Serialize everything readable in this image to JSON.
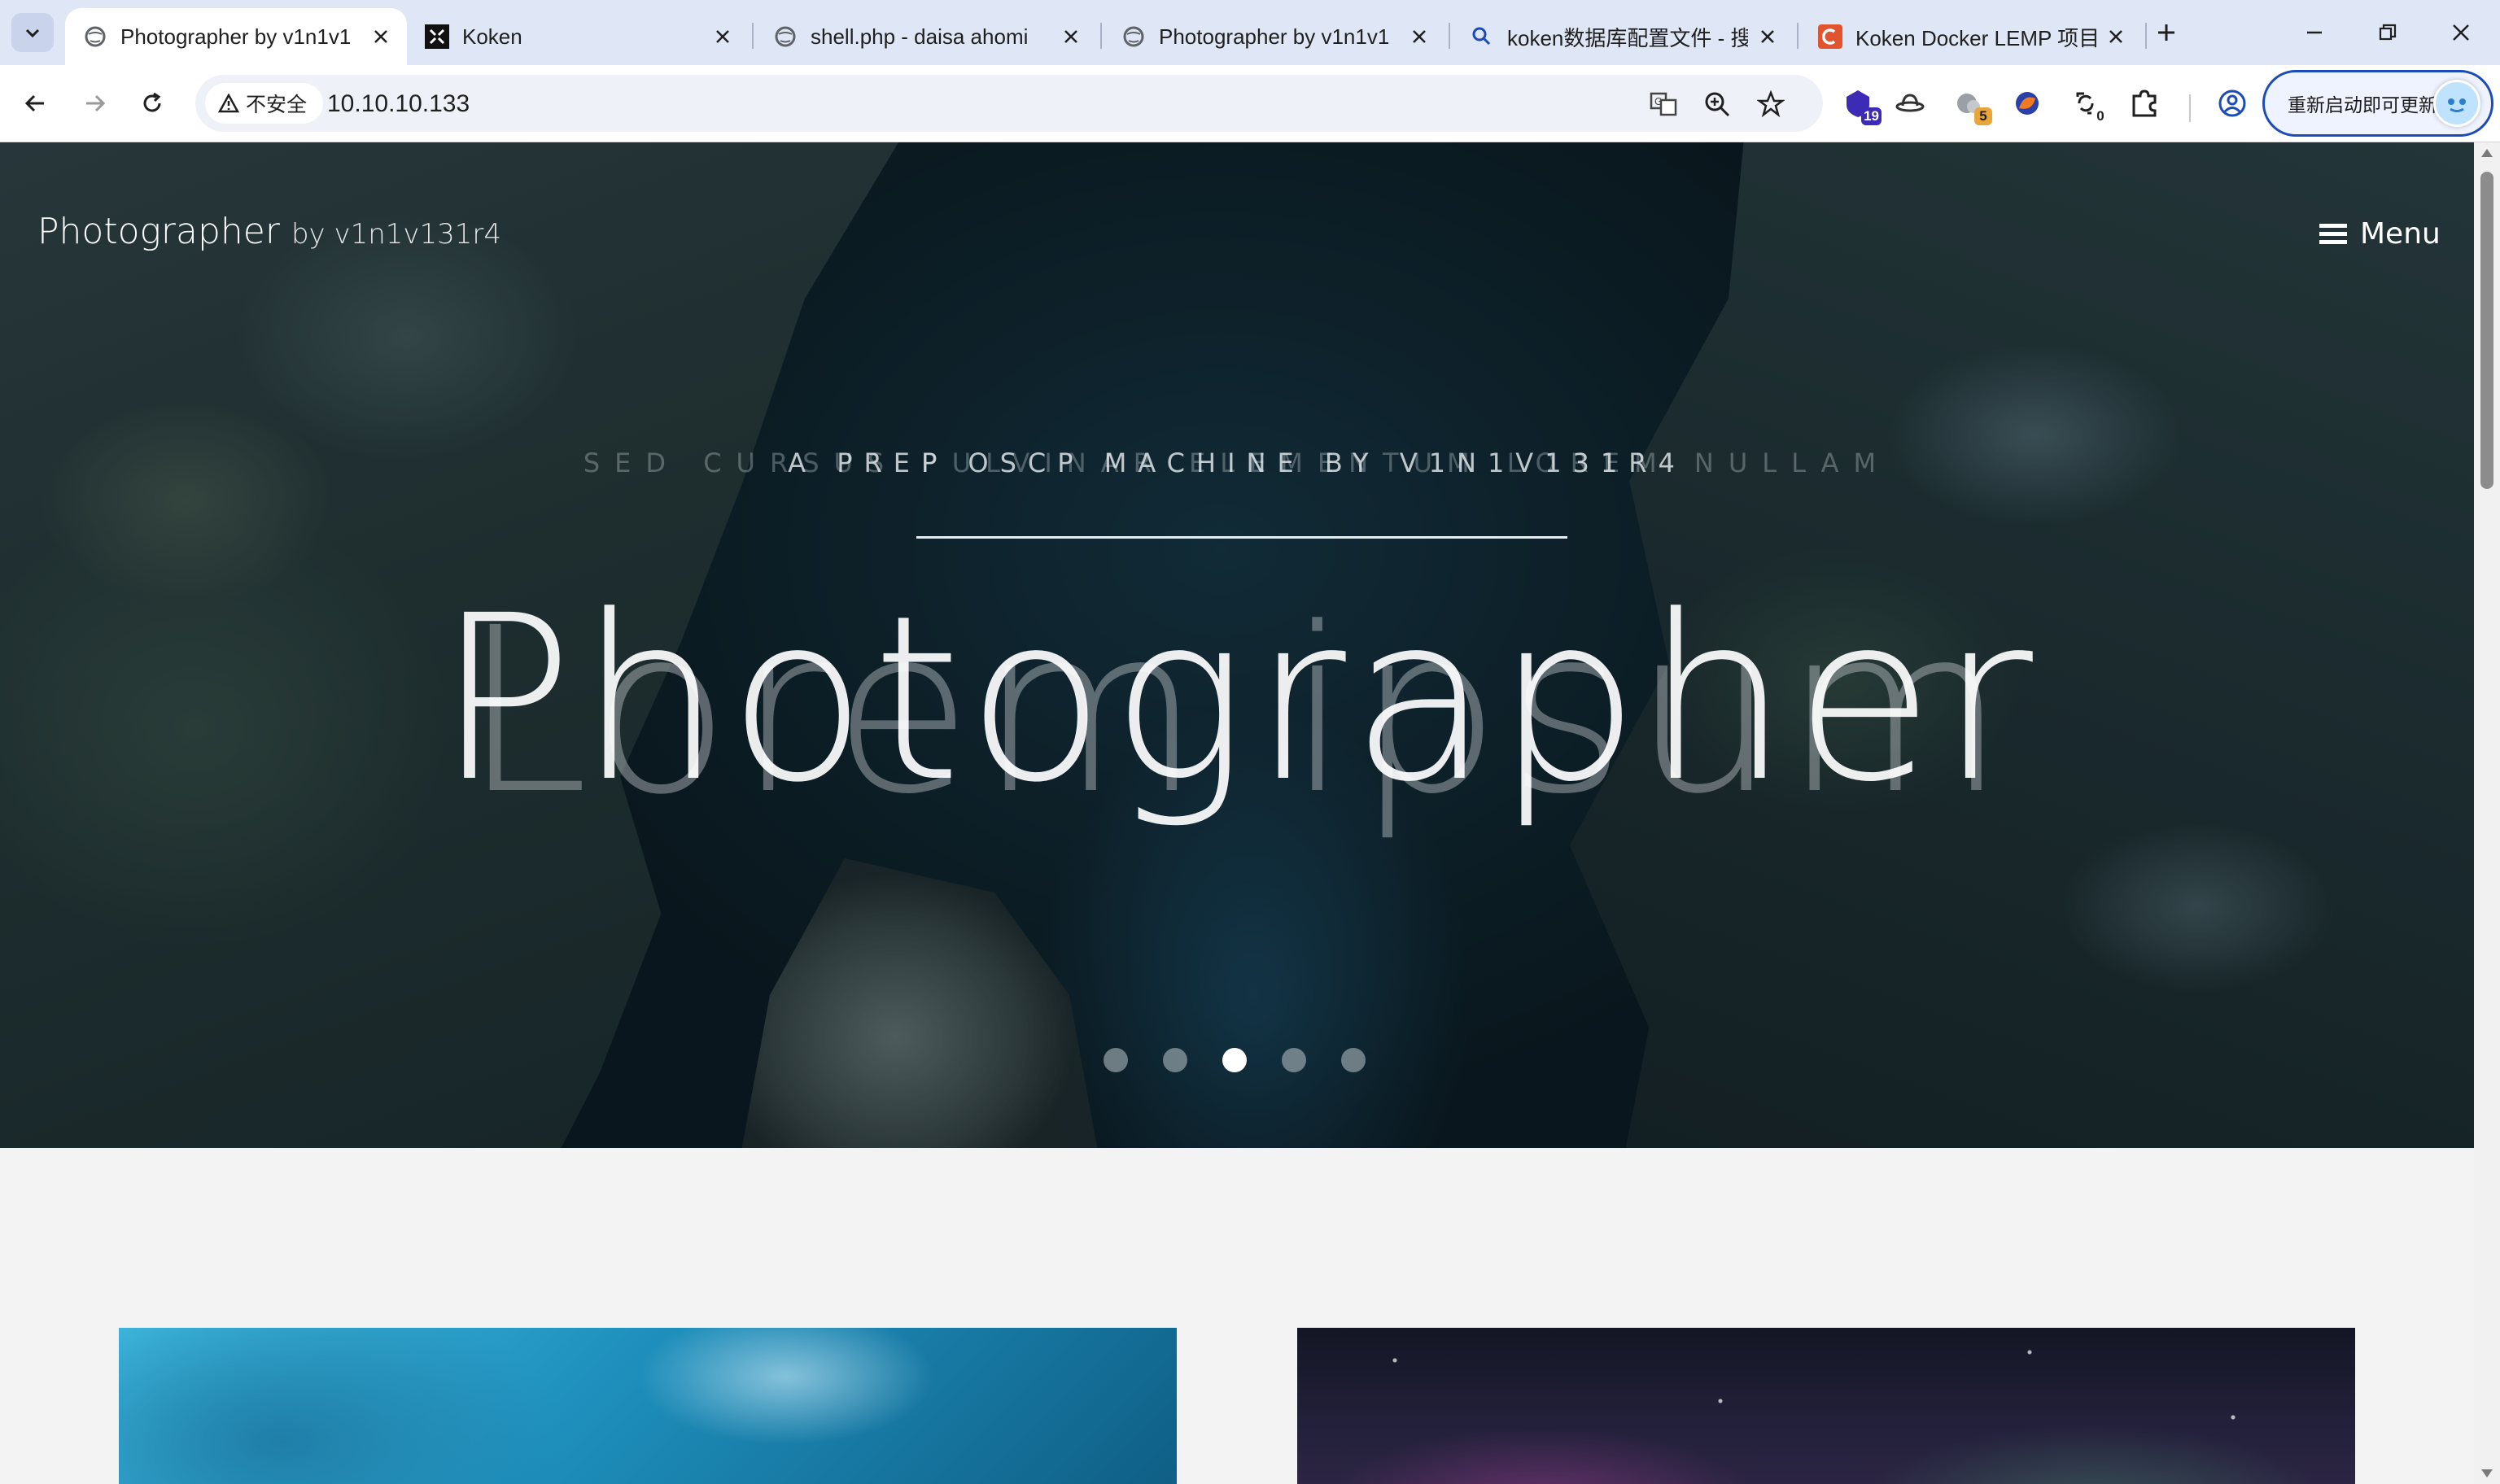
{
  "browser": {
    "tabs": [
      {
        "title": "Photographer by v1n1v1",
        "active": true,
        "favicon": "globe-icon"
      },
      {
        "title": "Koken",
        "active": false,
        "favicon": "koken-icon"
      },
      {
        "title": "shell.php - daisa ahomi",
        "active": false,
        "favicon": "globe-icon"
      },
      {
        "title": "Photographer by v1n1v1",
        "active": false,
        "favicon": "globe-icon"
      },
      {
        "title": "koken数据库配置文件 - 搜",
        "active": false,
        "favicon": "search-icon"
      },
      {
        "title": "Koken Docker LEMP 项目",
        "active": false,
        "favicon": "c-logo-icon"
      }
    ],
    "security_label": "不安全",
    "url": "10.10.10.133",
    "extensions": [
      {
        "name": "shield-extension-icon",
        "badge": "19",
        "badge_color": "#3b2bb5"
      },
      {
        "name": "hat-extension-icon",
        "badge": ""
      },
      {
        "name": "cloud-extension-icon",
        "badge": "5",
        "badge_color": "#e8a53a"
      },
      {
        "name": "fox-extension-icon",
        "badge": ""
      },
      {
        "name": "sync-extension-icon",
        "badge": "0",
        "badge_color": "#ffffff"
      }
    ],
    "update_button": "重新启动即可更新",
    "accent": "#1a4bb8"
  },
  "page": {
    "site_title": "Photographer",
    "site_by": "by v1n1v131r4",
    "menu_label": "Menu",
    "hero": {
      "kicker": "A PREP OSCP MACHINE BY V1N1V131R4",
      "kicker_ghost": "SED CURSUS PULVINAR ELEMENTUM LOREM NULLAM",
      "headline": "Photographer",
      "headline_ghost": "Lorem ipsum"
    },
    "slider": {
      "count": 5,
      "active_index": 2
    }
  }
}
